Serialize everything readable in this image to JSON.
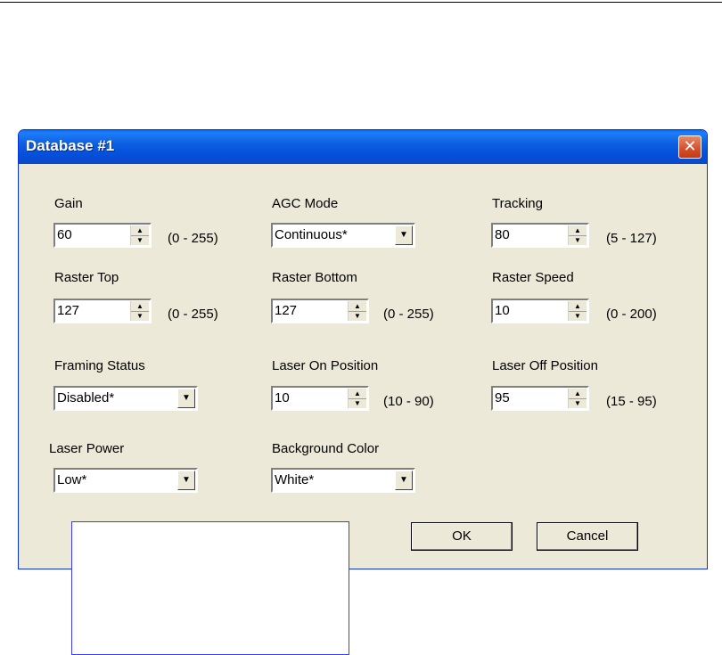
{
  "window": {
    "title": "Database #1"
  },
  "fields": {
    "gain": {
      "label": "Gain",
      "value": "60",
      "range": "(0 - 255)"
    },
    "agc_mode": {
      "label": "AGC Mode",
      "value": "Continuous*"
    },
    "tracking": {
      "label": "Tracking",
      "value": "80",
      "range": "(5 - 127)"
    },
    "raster_top": {
      "label": "Raster Top",
      "value": "127",
      "range": "(0 - 255)"
    },
    "raster_bottom": {
      "label": "Raster Bottom",
      "value": "127",
      "range": "(0 - 255)"
    },
    "raster_speed": {
      "label": "Raster Speed",
      "value": "10",
      "range": "(0 - 200)"
    },
    "framing_status": {
      "label": "Framing Status",
      "value": "Disabled*"
    },
    "laser_on_position": {
      "label": "Laser On Position",
      "value": "10",
      "range": "(10 - 90)"
    },
    "laser_off_position": {
      "label": "Laser Off Position",
      "value": "95",
      "range": "(15 - 95)"
    },
    "laser_power": {
      "label": "Laser Power",
      "value": "Low*"
    },
    "background_color": {
      "label": "Background Color",
      "value": "White*"
    }
  },
  "buttons": {
    "ok": "OK",
    "cancel": "Cancel"
  },
  "icons": {
    "close": "close-icon",
    "spin": "spinner-arrows-icon",
    "dropdown": "chevron-down-icon"
  },
  "colors": {
    "titlebar": "#0550dc",
    "dialog_bg": "#ece9d8",
    "close_button": "#d44e2a",
    "callout_border": "#3b3bff"
  }
}
